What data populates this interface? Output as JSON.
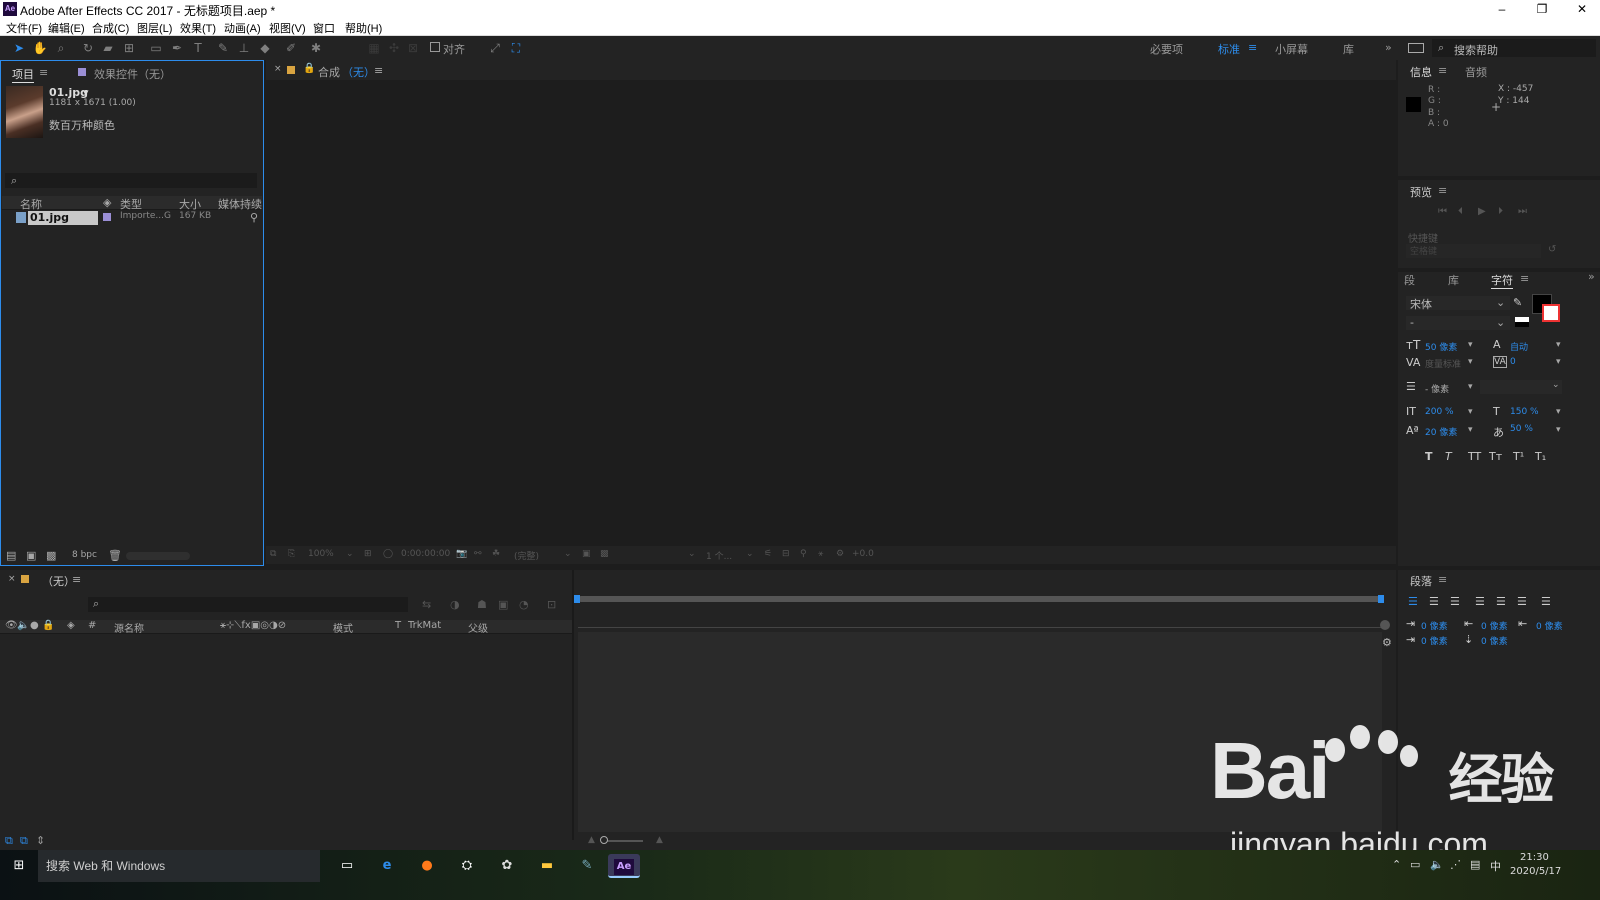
{
  "window": {
    "title": "Adobe After Effects CC 2017 - 无标题项目.aep *",
    "app_icon": "Ae",
    "controls": [
      "–",
      "❐",
      "✕"
    ]
  },
  "menu": [
    "文件(F)",
    "编辑(E)",
    "合成(C)",
    "图层(L)",
    "效果(T)",
    "动画(A)",
    "视图(V)",
    "窗口",
    "帮助(H)"
  ],
  "toolbar": {
    "align_label": "对齐",
    "workspaces": [
      "必要项",
      "标准",
      "小屏幕",
      "库"
    ],
    "active_workspace": "标准",
    "search_help": "搜索帮助"
  },
  "project_panel": {
    "tab_project": "项目",
    "tab_effects": "效果控件（无）",
    "file_name": "01.jpg",
    "file_dims": "1181 x 1671 (1.00)",
    "file_colors": "数百万种颜色",
    "columns": [
      "名称",
      "类型",
      "大小",
      "媒体持续"
    ],
    "rows": [
      {
        "name": "01.jpg",
        "type": "Importe...G",
        "size": "167 KB"
      }
    ],
    "bit_depth": "8 bpc"
  },
  "viewer": {
    "comp_label": "合成",
    "comp_name": "（无）",
    "zoom": "100%",
    "timecode": "0:00:00:00",
    "resolution": "(完整)",
    "views": "1 个...",
    "exposure": "+0.0"
  },
  "info_panel": {
    "tab_info": "信息",
    "tab_audio": "音频",
    "r": "R :",
    "g": "G :",
    "b": "B :",
    "a": "A : 0",
    "x": "X : -457",
    "y": "Y : 144"
  },
  "preview_panel": {
    "title": "预览",
    "shortcut_label": "快捷键",
    "shortcut_value": "空格键"
  },
  "char_panel": {
    "tabs": [
      "段",
      "库",
      "字符"
    ],
    "font": "宋体",
    "style": "-",
    "size": "50 像素",
    "leading": "自动",
    "kerning": "度量标准",
    "tracking": "0",
    "stroke": "- 像素",
    "vscale": "200 %",
    "hscale": "150 %",
    "baseline": "20 像素",
    "tsume": "50 %",
    "styles": [
      "T",
      "T",
      "TT",
      "Tт",
      "T¹",
      "T₁"
    ]
  },
  "para_panel": {
    "title": "段落",
    "indent_left": "0 像素",
    "indent_first": "0 像素",
    "indent_right": "0 像素",
    "space_before": "0 像素",
    "space_after": "0 像素"
  },
  "timeline": {
    "tab": "（无）",
    "columns": [
      "源名称",
      "模式",
      "T",
      "TrkMat",
      "父级"
    ]
  },
  "taskbar": {
    "search": "搜索 Web 和 Windows",
    "time": "21:30",
    "date": "2020/5/17",
    "ime": "中"
  },
  "watermark": {
    "brand": "Bai",
    "brand_cn": "经验",
    "url": "jingyan.baidu.com"
  }
}
